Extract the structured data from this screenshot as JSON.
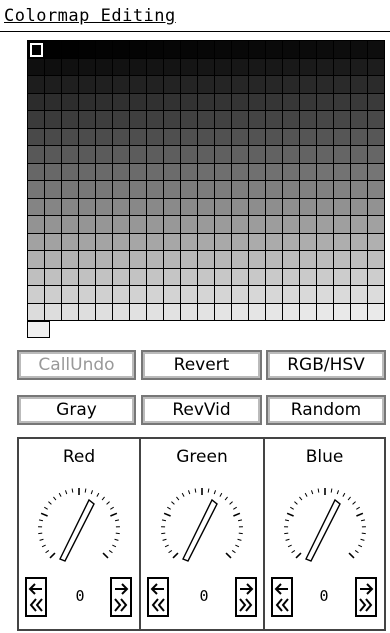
{
  "title": "Colormap Editing",
  "palette": {
    "rows": 16,
    "cols": 21,
    "selected_index": 0,
    "last_cell_color": "#f0f0f0"
  },
  "buttons": {
    "undo": "CallUndo",
    "revert": "Revert",
    "rgb_hsv": "RGB/HSV",
    "gray": "Gray",
    "revvid": "RevVid",
    "random": "Random"
  },
  "channels": [
    {
      "label": "Red",
      "value": "0"
    },
    {
      "label": "Green",
      "value": "0"
    },
    {
      "label": "Blue",
      "value": "0"
    }
  ]
}
